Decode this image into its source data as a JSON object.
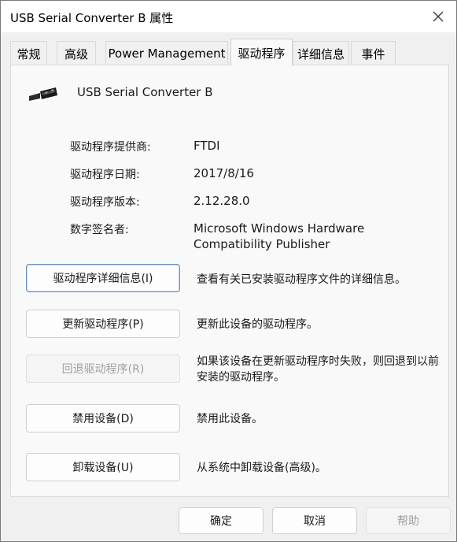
{
  "window": {
    "title": "USB Serial Converter B 属性",
    "close_label": "✕"
  },
  "tabs": [
    {
      "label": "常规",
      "active": false
    },
    {
      "label": "高级",
      "active": false
    },
    {
      "label": "Power Management",
      "active": false
    },
    {
      "label": "驱动程序",
      "active": true
    },
    {
      "label": "详细信息",
      "active": false
    },
    {
      "label": "事件",
      "active": false
    }
  ],
  "device": {
    "name": "USB Serial Converter B",
    "icon": "usb-plug-icon"
  },
  "properties": [
    {
      "label": "驱动程序提供商:",
      "value": "FTDI"
    },
    {
      "label": "驱动程序日期:",
      "value": "2017/8/16"
    },
    {
      "label": "驱动程序版本:",
      "value": "2.12.28.0"
    },
    {
      "label": "数字签名者:",
      "value": "Microsoft Windows Hardware Compatibility Publisher"
    }
  ],
  "actions": [
    {
      "label": "驱动程序详细信息(I)",
      "description": "查看有关已安装驱动程序文件的详细信息。",
      "enabled": true,
      "focused": true
    },
    {
      "label": "更新驱动程序(P)",
      "description": "更新此设备的驱动程序。",
      "enabled": true,
      "focused": false
    },
    {
      "label": "回退驱动程序(R)",
      "description": "如果该设备在更新驱动程序时失败，则回退到以前安装的驱动程序。",
      "enabled": false,
      "focused": false
    },
    {
      "label": "禁用设备(D)",
      "description": "禁用此设备。",
      "enabled": true,
      "focused": false
    },
    {
      "label": "卸载设备(U)",
      "description": "从系统中卸载设备(高级)。",
      "enabled": true,
      "focused": false
    }
  ],
  "footer": {
    "ok_label": "确定",
    "cancel_label": "取消",
    "help_label": "帮助"
  },
  "colors": {
    "focus_border": "#6e8fb8",
    "disabled_text": "#a0a0a0"
  }
}
